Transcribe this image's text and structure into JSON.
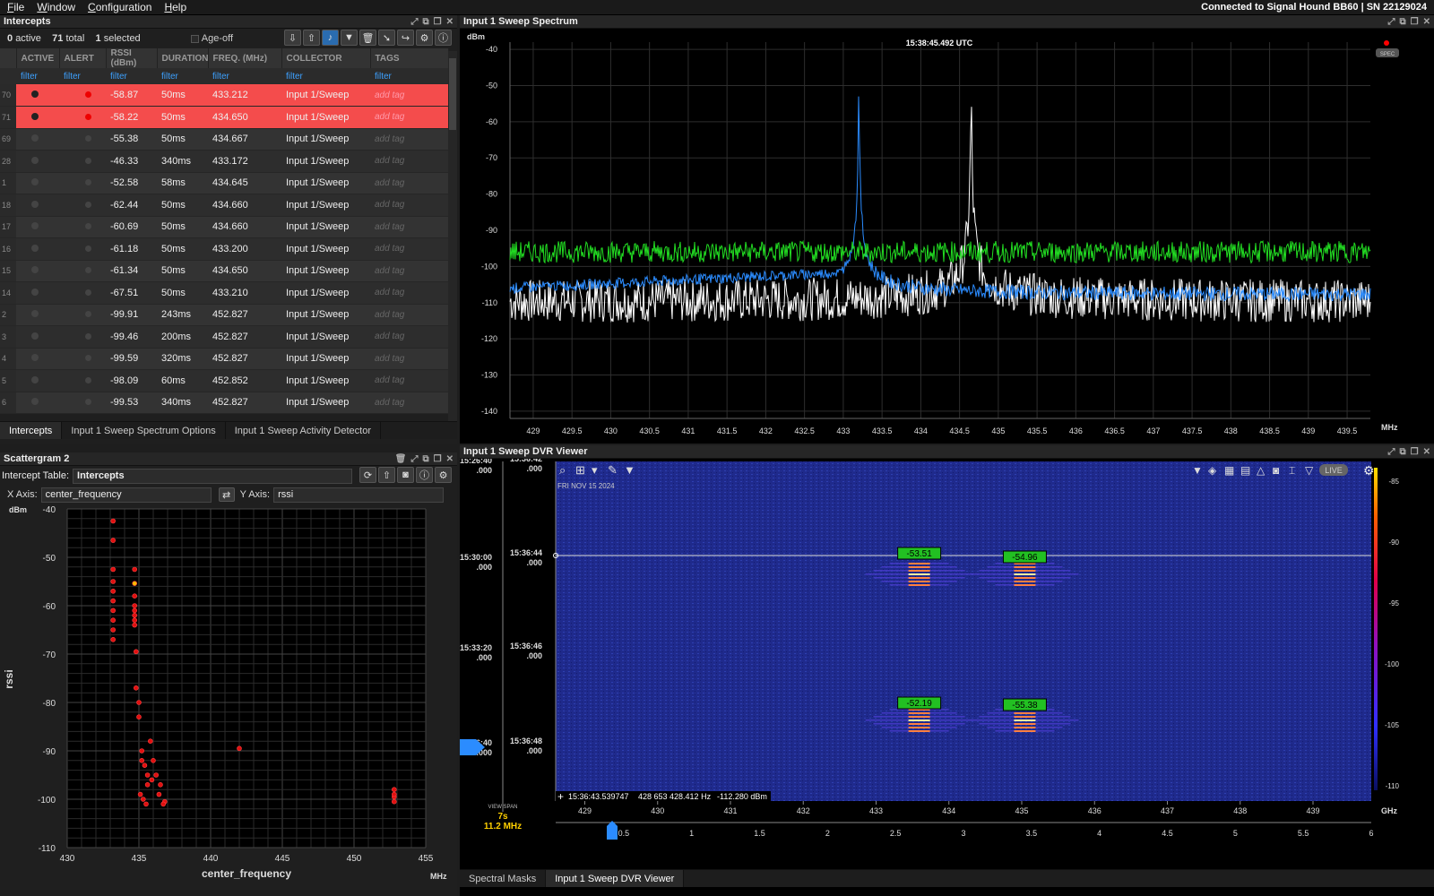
{
  "menu": [
    "File",
    "Window",
    "Configuration",
    "Help"
  ],
  "connection": "Connected to Signal Hound BB60 | SN 22129024",
  "intercepts": {
    "title": "Intercepts",
    "active": "0",
    "active_label": "active",
    "total": "71",
    "total_label": "total",
    "selected": "1",
    "selected_label": "selected",
    "ageoff": "Age-off",
    "columns": [
      "ACTIVE",
      "ALERT",
      "RSSI (dBm)",
      "DURATION",
      "FREQ. (MHz)",
      "COLLECTOR",
      "TAGS"
    ],
    "filter": "filter",
    "add_tag": "add tag",
    "rows": [
      {
        "n": "70",
        "rssi": "-58.87",
        "dur": "50ms",
        "freq": "433.212",
        "col": "Input 1/Sweep",
        "alert": true
      },
      {
        "n": "71",
        "rssi": "-58.22",
        "dur": "50ms",
        "freq": "434.650",
        "col": "Input 1/Sweep",
        "alert": true
      },
      {
        "n": "69",
        "rssi": "-55.38",
        "dur": "50ms",
        "freq": "434.667",
        "col": "Input 1/Sweep"
      },
      {
        "n": "28",
        "rssi": "-46.33",
        "dur": "340ms",
        "freq": "433.172",
        "col": "Input 1/Sweep"
      },
      {
        "n": "1",
        "rssi": "-52.58",
        "dur": "58ms",
        "freq": "434.645",
        "col": "Input 1/Sweep"
      },
      {
        "n": "18",
        "rssi": "-62.44",
        "dur": "50ms",
        "freq": "434.660",
        "col": "Input 1/Sweep"
      },
      {
        "n": "17",
        "rssi": "-60.69",
        "dur": "50ms",
        "freq": "434.660",
        "col": "Input 1/Sweep"
      },
      {
        "n": "16",
        "rssi": "-61.18",
        "dur": "50ms",
        "freq": "433.200",
        "col": "Input 1/Sweep"
      },
      {
        "n": "15",
        "rssi": "-61.34",
        "dur": "50ms",
        "freq": "434.650",
        "col": "Input 1/Sweep"
      },
      {
        "n": "14",
        "rssi": "-67.51",
        "dur": "50ms",
        "freq": "433.210",
        "col": "Input 1/Sweep"
      },
      {
        "n": "2",
        "rssi": "-99.91",
        "dur": "243ms",
        "freq": "452.827",
        "col": "Input 1/Sweep"
      },
      {
        "n": "3",
        "rssi": "-99.46",
        "dur": "200ms",
        "freq": "452.827",
        "col": "Input 1/Sweep"
      },
      {
        "n": "4",
        "rssi": "-99.59",
        "dur": "320ms",
        "freq": "452.827",
        "col": "Input 1/Sweep"
      },
      {
        "n": "5",
        "rssi": "-98.09",
        "dur": "60ms",
        "freq": "452.852",
        "col": "Input 1/Sweep"
      },
      {
        "n": "6",
        "rssi": "-99.53",
        "dur": "340ms",
        "freq": "452.827",
        "col": "Input 1/Sweep"
      }
    ],
    "tabs": [
      "Intercepts",
      "Input 1 Sweep Spectrum Options",
      "Input 1 Sweep Activity Detector"
    ]
  },
  "scatter": {
    "title": "Scattergram 2",
    "table_label": "Intercept Table:",
    "table_value": "Intercepts",
    "x_label": "X Axis:",
    "x_value": "center_frequency",
    "y_label": "Y Axis:",
    "y_value": "rssi",
    "unit_y": "dBm",
    "unit_x": "MHz",
    "axis_x": "center_frequency",
    "axis_y": "rssi"
  },
  "spectrum": {
    "title": "Input 1 Sweep Spectrum",
    "timestamp": "15:38:45.492 UTC",
    "unit_y": "dBm",
    "unit_x": "MHz",
    "spec": "SPEC"
  },
  "dvr": {
    "title": "Input 1 Sweep DVR Viewer",
    "date": "FRI NOV 15 2024",
    "live": "LIVE",
    "readout_time": "15:36:43.539747",
    "readout_freq": "428 653 428.412 Hz",
    "readout_level": "-112.280 dBm",
    "view_span_label": "VIEW SPAN",
    "view_span_time": "7s",
    "view_span_freq": "11.2 MHz",
    "time_outer": [
      {
        "t": "15:26:40",
        "f": ".000"
      },
      {
        "t": "15:30:00",
        "f": ".000"
      },
      {
        "t": "15:33:20",
        "f": ".000"
      },
      {
        "t": "15:36:40",
        "f": ".000"
      }
    ],
    "time_inner": [
      {
        "t": "15:36:42",
        "f": ".000"
      },
      {
        "t": "15:36:44",
        "f": ".000"
      },
      {
        "t": "15:36:46",
        "f": ".000"
      },
      {
        "t": "15:36:48",
        "f": ".000"
      }
    ],
    "tags": [
      "-53.51",
      "-54.96",
      "-52.19",
      "-55.38"
    ],
    "x_ticks": [
      "429",
      "430",
      "431",
      "432",
      "433",
      "434",
      "435",
      "436",
      "437",
      "438",
      "439"
    ],
    "span_ticks": [
      "0.5",
      "1",
      "1.5",
      "2",
      "2.5",
      "3",
      "3.5",
      "4",
      "4.5",
      "5",
      "5.5",
      "6"
    ],
    "unit_x": "GHz",
    "colorbar": [
      "-85",
      "-90",
      "-95",
      "-100",
      "-105",
      "-110"
    ],
    "tabs": [
      "Spectral Masks",
      "Input 1 Sweep DVR Viewer"
    ]
  },
  "chart_data": [
    {
      "type": "scatter",
      "x": [
        433.2,
        433.2,
        433.2,
        433.2,
        434.7,
        434.7,
        434.7,
        434.7,
        434.7,
        434.8,
        434.8,
        435,
        435,
        435.2,
        435.4,
        435.6,
        435.8,
        436,
        436.2,
        436.5,
        436.8,
        442,
        452.8,
        452.8,
        452.8
      ],
      "y": [
        -42.5,
        -46.5,
        -52.5,
        -55,
        -52.5,
        -55.4,
        -58,
        -61,
        -63,
        -69.5,
        -77,
        -80,
        -83,
        -90,
        -93,
        -95,
        -88,
        -92,
        -95,
        -97,
        -100.5,
        -89.5,
        -98,
        -99.5,
        -100.5
      ],
      "xlabel": "center_frequency",
      "ylabel": "rssi",
      "xlim": [
        430,
        455
      ],
      "ylim": [
        -110,
        -40
      ],
      "xticks": [
        "430",
        "435",
        "440",
        "445",
        "450",
        "455"
      ],
      "yticks": [
        "-40",
        "-50",
        "-60",
        "-70",
        "-80",
        "-90",
        "-100",
        "-110"
      ]
    },
    {
      "type": "line",
      "xlim": [
        428.7,
        439.8
      ],
      "ylim": [
        -142,
        -38
      ],
      "xticks": [
        "429",
        "429.5",
        "430",
        "430.5",
        "431",
        "431.5",
        "432",
        "432.5",
        "433",
        "433.5",
        "434",
        "434.5",
        "435",
        "435.5",
        "436",
        "436.5",
        "437",
        "437.5",
        "438",
        "438.5",
        "439",
        "439.5"
      ],
      "yticks": [
        "-40",
        "-50",
        "-60",
        "-70",
        "-80",
        "-90",
        "-100",
        "-110",
        "-120",
        "-130",
        "-140"
      ],
      "peaks": [
        433.2,
        434.65
      ],
      "peak_levels": [
        -46,
        -46
      ],
      "noise_floor": -108,
      "green_floor": -96
    }
  ]
}
